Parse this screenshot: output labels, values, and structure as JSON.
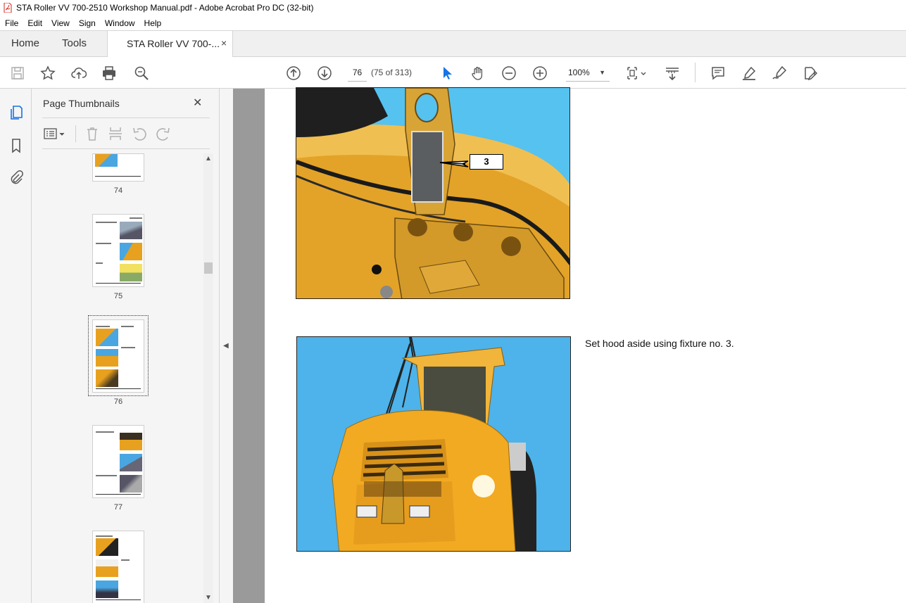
{
  "window": {
    "title": "STA Roller VV 700-2510 Workshop Manual.pdf - Adobe Acrobat Pro DC (32-bit)"
  },
  "menu": [
    "File",
    "Edit",
    "View",
    "Sign",
    "Window",
    "Help"
  ],
  "tabs": {
    "home": "Home",
    "tools": "Tools",
    "document": "STA Roller VV 700-...",
    "close": "×"
  },
  "toolbar": {
    "page_current": "76",
    "page_count": "(75 of 313)",
    "zoom": "100%",
    "icons": [
      "save-icon",
      "star-icon",
      "upload-icon",
      "print-icon",
      "zoom-search-icon",
      "prev-page-icon",
      "next-page-icon",
      "select-arrow-icon",
      "hand-icon",
      "zoom-out-icon",
      "zoom-in-icon",
      "fit-page-icon",
      "scroll-mode-icon",
      "comment-icon",
      "highlight-icon",
      "sign-icon",
      "redact-icon"
    ]
  },
  "left_strip": {
    "icons": [
      "pages-icon",
      "bookmark-icon",
      "attachment-icon"
    ]
  },
  "thumbnails_panel": {
    "title": "Page Thumbnails",
    "close": "✕",
    "pages": [
      "74",
      "75",
      "76",
      "77"
    ]
  },
  "document": {
    "caption": "Set hood aside using fixture no. 3.",
    "callout": "3"
  },
  "colors": {
    "accent": "#1473e6",
    "sky": "#55b8ee",
    "machine_yellow": "#e8a11e",
    "pdf_red": "#d7251e"
  }
}
